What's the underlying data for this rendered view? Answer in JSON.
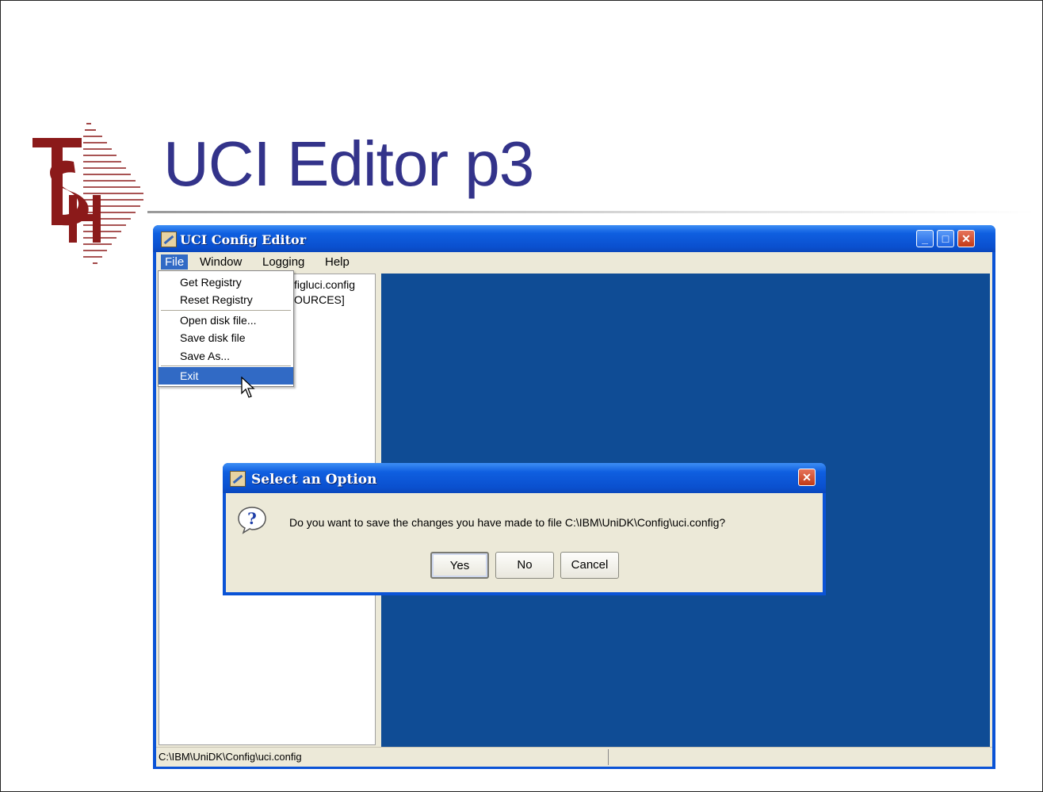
{
  "slide": {
    "title": "UCI Editor p3"
  },
  "window": {
    "title": "UCI Config Editor",
    "menu": [
      "File",
      "Window",
      "Logging",
      "Help"
    ],
    "active_menu": "File",
    "tree_lines": [
      "figluci.config",
      "OURCES]"
    ],
    "status_text": "C:\\IBM\\UniDK\\Config\\uci.config"
  },
  "file_menu": {
    "items": [
      "Get Registry",
      "Reset Registry",
      "Open disk file...",
      "Save disk file",
      "Save As...",
      "Exit"
    ],
    "selected": "Exit"
  },
  "dialog": {
    "title": "Select an Option",
    "message": "Do you want to save the changes you have made to file C:\\IBM\\UniDK\\Config\\uci.config?",
    "buttons": {
      "yes": "Yes",
      "no": "No",
      "cancel": "Cancel"
    }
  },
  "colors": {
    "title_blue": "#33338a",
    "xp_blue": "#0a53d6",
    "pane_blue": "#0f4c95",
    "logo_red": "#8b1a1a"
  }
}
